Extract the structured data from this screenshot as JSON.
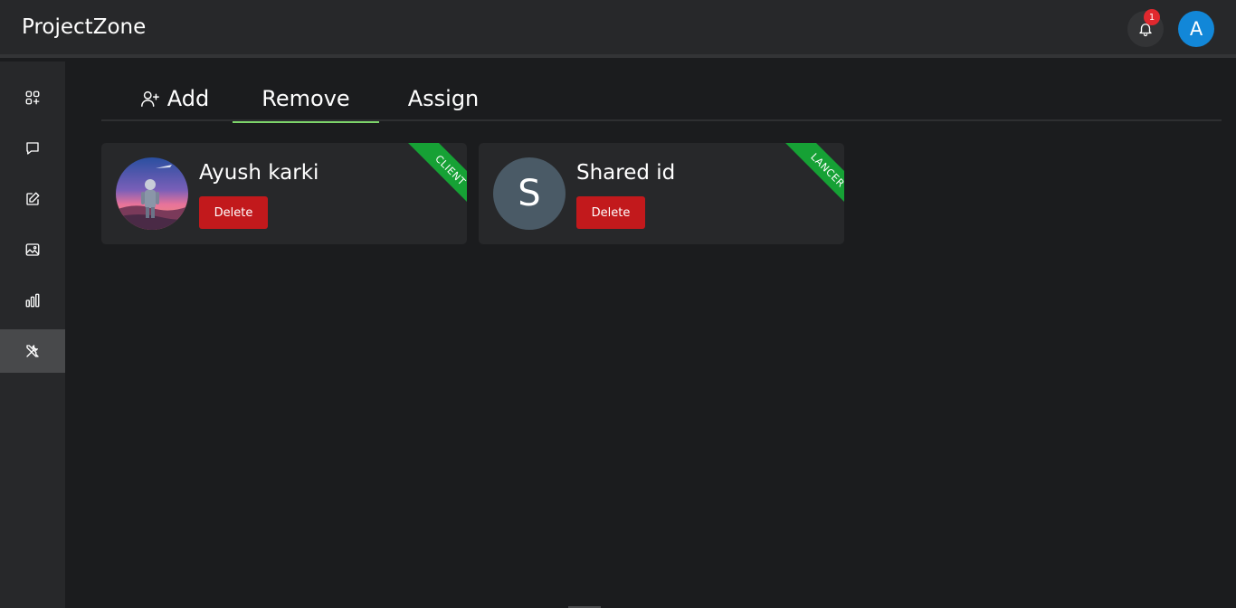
{
  "app": {
    "title": "ProjectZone"
  },
  "header": {
    "notifications_count": "1",
    "user_avatar_letter": "A"
  },
  "sidebar": {
    "items": [
      {
        "icon": "apps-add-icon",
        "active": false
      },
      {
        "icon": "chat-icon",
        "active": false
      },
      {
        "icon": "edit-icon",
        "active": false
      },
      {
        "icon": "image-icon",
        "active": false
      },
      {
        "icon": "bar-chart-icon",
        "active": false
      },
      {
        "icon": "tools-icon",
        "active": true
      }
    ]
  },
  "tabs": [
    {
      "label": "Add",
      "icon": "add-user-icon",
      "active": false
    },
    {
      "label": "Remove",
      "active": true
    },
    {
      "label": "Assign",
      "active": false
    }
  ],
  "users": [
    {
      "name": "Ayush karki",
      "role": "CLIENT",
      "delete_label": "Delete",
      "avatar": "photo"
    },
    {
      "name": "Shared id",
      "role": "LANCER",
      "delete_label": "Delete",
      "avatar_letter": "S"
    }
  ],
  "colors": {
    "accent_tab": "#7dd46a",
    "delete": "#c2191c",
    "ribbon": "#16a135",
    "avatar_blue": "#1287d8"
  }
}
